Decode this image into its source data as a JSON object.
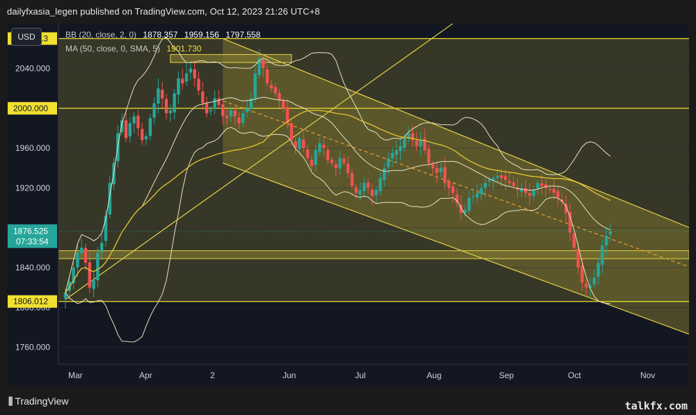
{
  "header": {
    "published_by": "dailyfxasia_legen published on TradingView.com, Oct 12, 2023 21:26 UTC+8"
  },
  "toolbar": {
    "currency": "USD"
  },
  "legend": {
    "bb_label": "BB (20, close, 2, 0)",
    "bb_values": [
      "1878.357",
      "1959.156",
      "1797.558"
    ],
    "ma_label": "MA (50, close, 0, SMA, 5)",
    "ma_value": "1901.730"
  },
  "footer": {
    "logo": "TradingView",
    "watermark": "talkfx.com"
  },
  "colors": {
    "background": "#131722",
    "up": "#26a69a",
    "down": "#ef5350",
    "channel_line": "#e6d34a",
    "bands": "#e8e4c0",
    "sma": "#e6c630",
    "fill": "#7a7330",
    "label_bg": "#f0e030",
    "last_price": "#26a69a"
  },
  "chart_data": {
    "type": "candlestick",
    "symbol": "XAUUSD",
    "y_ticks": [
      2040,
      2000,
      1960,
      1920,
      1880,
      1840,
      1800,
      1760
    ],
    "y_tick_labels": [
      "2040.000",
      "2000.000",
      "1960.000",
      "1920.000",
      "1880.000",
      "1840.000",
      "1800.000",
      "1760.000"
    ],
    "ylim": [
      1743,
      2085
    ],
    "x_ticks": [
      "Mar",
      "Apr",
      "2",
      "Jun",
      "Jul",
      "Aug",
      "Sep",
      "Oct",
      "Nov"
    ],
    "horizontal_levels": [
      {
        "value": 2070.013,
        "label": "2070.013"
      },
      {
        "value": 2000.0,
        "label": "2000.000"
      },
      {
        "value": 1806.012,
        "label": "1806.012"
      }
    ],
    "last_price": {
      "value": 1876.525,
      "label": "1876.525",
      "countdown": "07:33:54"
    },
    "zones": [
      {
        "name": "resistance-zone",
        "from": 2046,
        "to": 2054
      },
      {
        "name": "support-zone",
        "from": 1849,
        "to": 1857
      }
    ],
    "channel": {
      "upper_start": 2070,
      "upper_end": 1868,
      "mid_end": 1830,
      "lower_start": 1945,
      "lower_end": 1762
    },
    "trendline_start": 1808,
    "trendline_end": 2143,
    "closes": [
      1815,
      1826,
      1840,
      1855,
      1860,
      1845,
      1820,
      1828,
      1855,
      1865,
      1892,
      1925,
      1945,
      1975,
      1988,
      1970,
      1985,
      1992,
      1980,
      1968,
      1972,
      1990,
      2005,
      2020,
      2010,
      1995,
      1998,
      2015,
      2030,
      2025,
      2035,
      2040,
      2030,
      2018,
      2005,
      1995,
      1998,
      2010,
      2003,
      1992,
      1990,
      1998,
      1992,
      1985,
      1995,
      2000,
      2010,
      2035,
      2050,
      2040,
      2025,
      2020,
      2015,
      2008,
      2000,
      1985,
      1968,
      1960,
      1970,
      1960,
      1950,
      1942,
      1958,
      1965,
      1960,
      1948,
      1945,
      1940,
      1950,
      1945,
      1935,
      1922,
      1915,
      1918,
      1925,
      1920,
      1912,
      1918,
      1930,
      1940,
      1950,
      1955,
      1958,
      1962,
      1970,
      1975,
      1968,
      1962,
      1968,
      1958,
      1945,
      1940,
      1935,
      1940,
      1925,
      1920,
      1915,
      1905,
      1895,
      1898,
      1910,
      1912,
      1915,
      1920,
      1925,
      1928,
      1930,
      1932,
      1930,
      1928,
      1925,
      1922,
      1918,
      1920,
      1915,
      1912,
      1918,
      1925,
      1922,
      1920,
      1918,
      1915,
      1910,
      1906,
      1895,
      1875,
      1860,
      1840,
      1825,
      1820,
      1822,
      1830,
      1845,
      1862,
      1872,
      1876.5
    ]
  }
}
